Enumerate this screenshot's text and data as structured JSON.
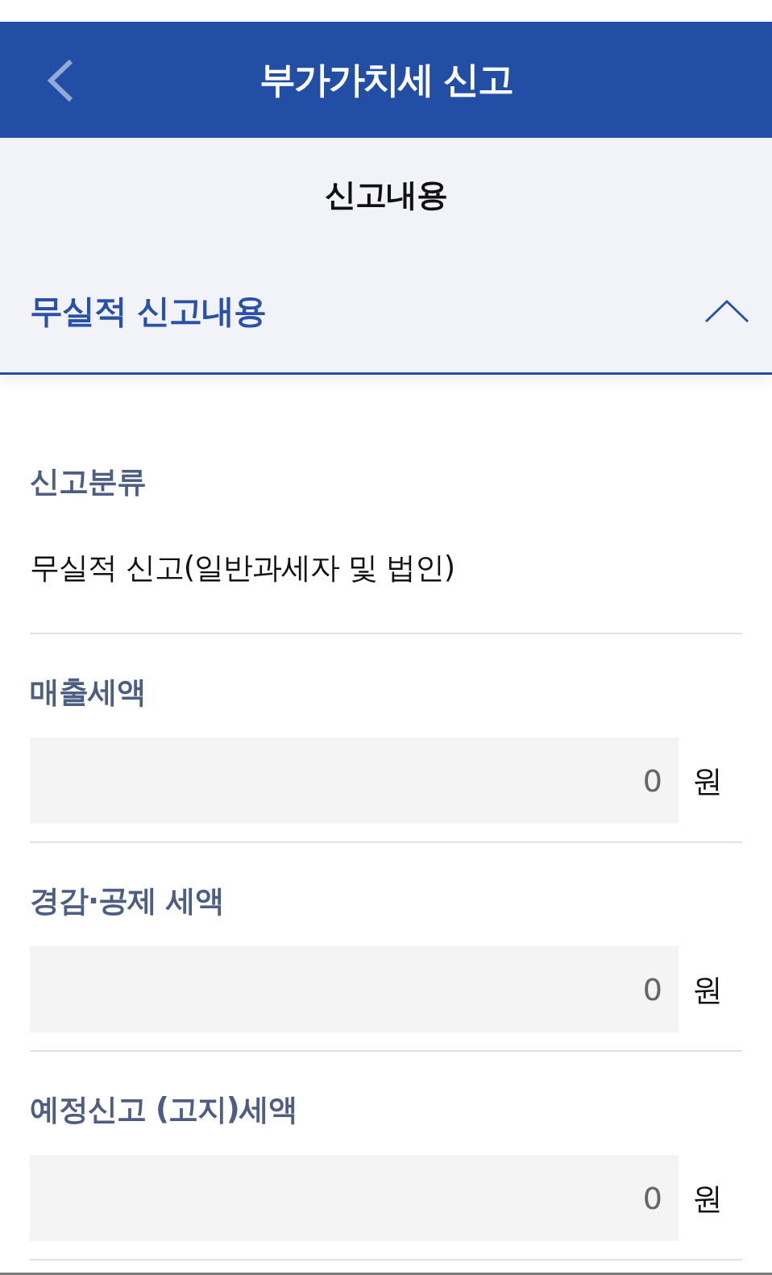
{
  "header": {
    "title": "부가가치세 신고"
  },
  "section": {
    "title": "신고내용"
  },
  "accordion": {
    "title": "무실적 신고내용",
    "expanded": true
  },
  "fields": [
    {
      "kind": "text",
      "label": "신고분류",
      "value": "무실적 신고(일반과세자 및 법인)"
    },
    {
      "kind": "amount",
      "label": "매출세액",
      "value": "0",
      "unit": "원"
    },
    {
      "kind": "amount",
      "label": "경감·공제 세액",
      "value": "0",
      "unit": "원"
    },
    {
      "kind": "amount",
      "label": "예정신고 (고지)세액",
      "value": "0",
      "unit": "원"
    }
  ]
}
